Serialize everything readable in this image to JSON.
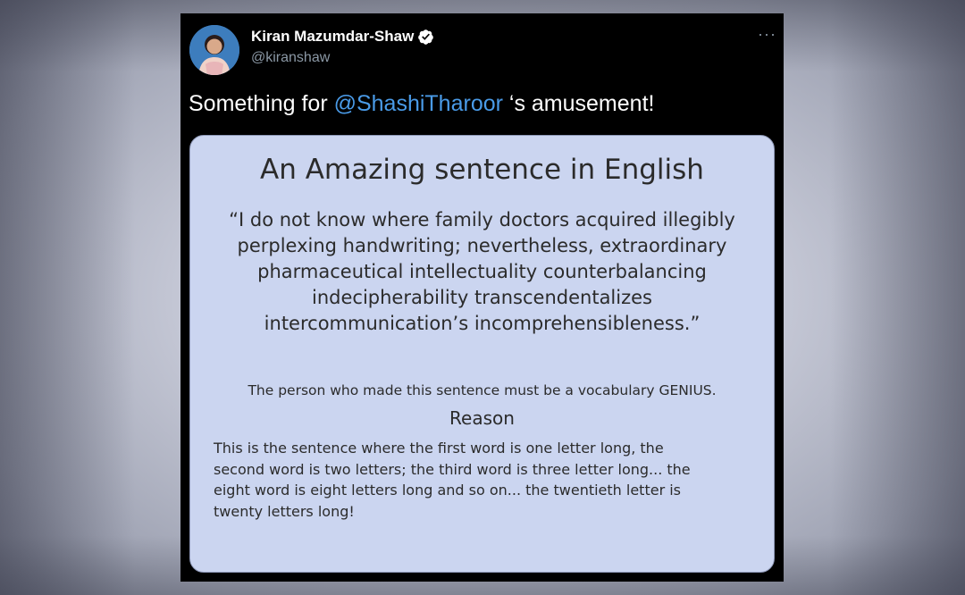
{
  "tweet": {
    "author_name": "Kiran Mazumdar-Shaw",
    "author_handle": "@kiranshaw",
    "text_before": "Something for ",
    "mention": "@ShashiTharoor",
    "text_after": " ‘s amusement!",
    "more_label": "···",
    "icons": {
      "verified": "verified-badge-icon",
      "more": "more-options-icon"
    },
    "colors": {
      "background": "#000000",
      "mention": "#4a9be8",
      "handle": "#8b98a5"
    }
  },
  "image": {
    "title": "An Amazing sentence in English",
    "quote_lines": [
      "“I do not know where family doctors acquired illegibly",
      "perplexing handwriting; nevertheless, extraordinary",
      "pharmaceutical intellectuality counterbalancing",
      "indecipherability transcendentalizes",
      "intercommunication’s incomprehensibleness.”"
    ],
    "genius_line": "The person who made this sentence must be a vocabulary GENIUS.",
    "reason_heading": "Reason",
    "explanation_lines": [
      "This is the sentence where the first word is one letter long, the",
      "second word is two letters; the third word is three letter long... the",
      "eight word is eight letters long and so on... the twentieth letter is",
      "twenty letters long!"
    ],
    "background_color": "#cbd5f0"
  }
}
